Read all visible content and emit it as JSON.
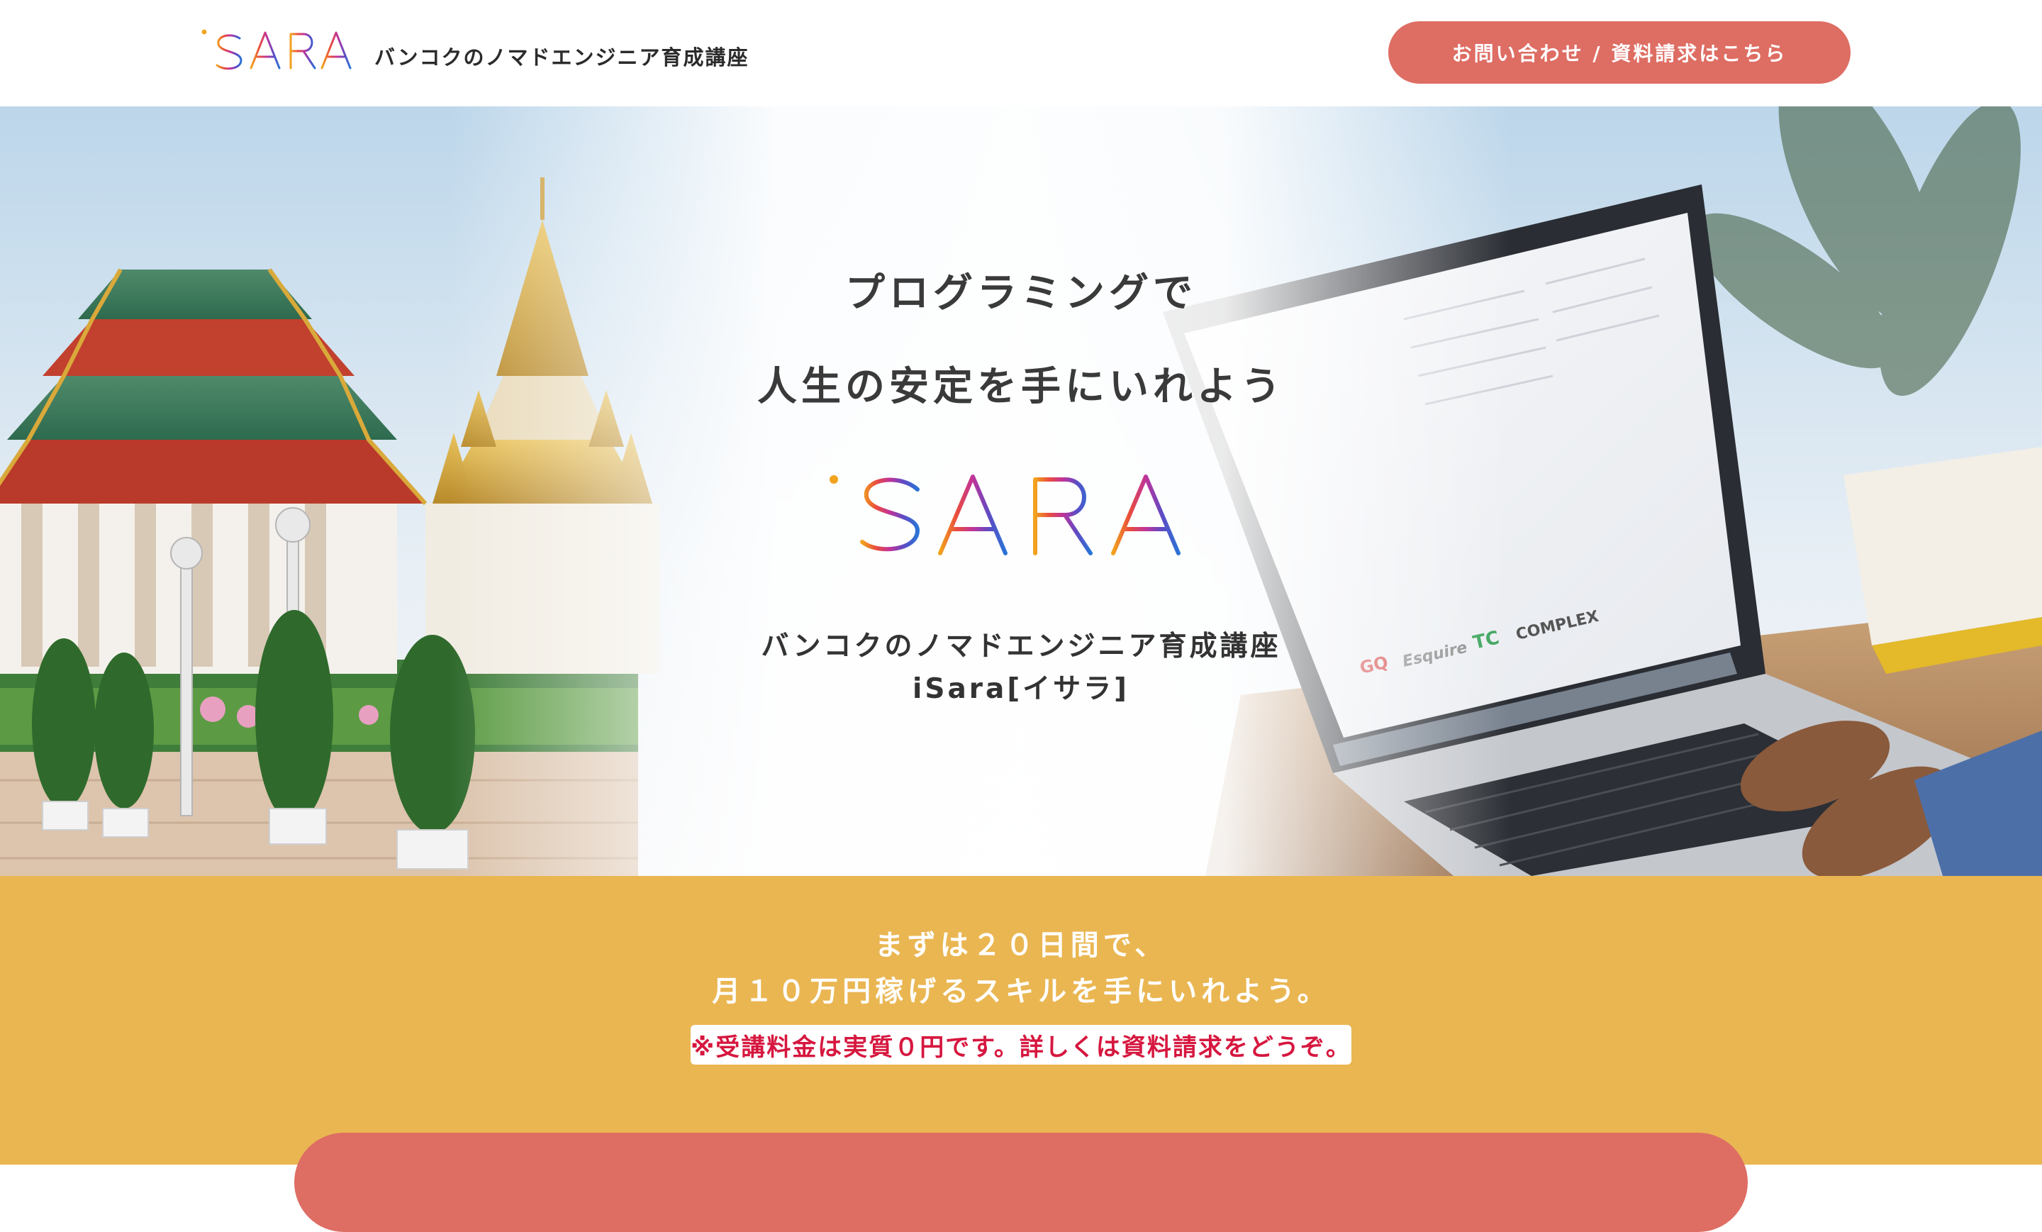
{
  "header": {
    "logo_text": "iSARA",
    "tagline": "バンコクのノマドエンジニア育成講座",
    "cta_label": "お問い合わせ / 資料請求はこちら"
  },
  "hero": {
    "headline_line1": "プログラミングで",
    "headline_line2": "人生の安定を手にいれよう",
    "logo_text": "iSARA",
    "subtitle_line1": "バンコクのノマドエンジニア育成講座",
    "subtitle_line2": "iSara[イサラ]",
    "screen_brands": [
      "GQ",
      "Esquire",
      "TC",
      "COMPLEX"
    ]
  },
  "band": {
    "line1": "まずは２０日間で、",
    "line2": "月１０万円稼げるスキルを手にいれよう。",
    "note": "※受講料金は実質０円です。詳しくは資料請求をどうぞ。"
  },
  "colors": {
    "accent": "#de6d63",
    "band": "#eab652",
    "note_text": "#d6173f",
    "text_dark": "#333333"
  }
}
